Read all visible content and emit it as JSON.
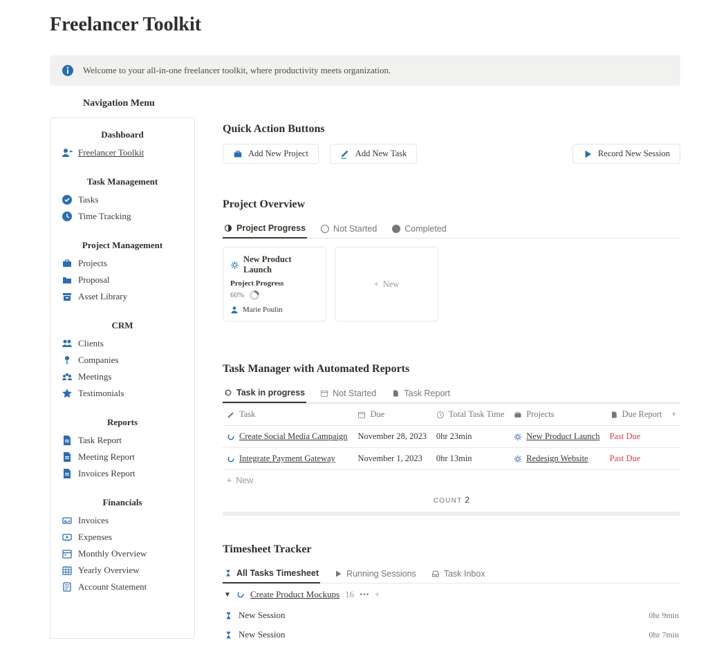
{
  "title": "Freelancer Toolkit",
  "callout": "Welcome to your all-in-one freelancer toolkit, where productivity meets organization.",
  "nav_title": "Navigation Menu",
  "sidebar": {
    "groups": [
      {
        "head": "Dashboard",
        "items": [
          {
            "icon": "user",
            "label": "Freelancer Toolkit",
            "underline": true
          }
        ]
      },
      {
        "head": "Task Management",
        "items": [
          {
            "icon": "check-circle",
            "label": "Tasks"
          },
          {
            "icon": "clock",
            "label": "Time Tracking"
          }
        ]
      },
      {
        "head": "Project Management",
        "items": [
          {
            "icon": "briefcase",
            "label": "Projects"
          },
          {
            "icon": "folder",
            "label": "Proposal"
          },
          {
            "icon": "archive",
            "label": "Asset Library"
          }
        ]
      },
      {
        "head": "CRM",
        "items": [
          {
            "icon": "users",
            "label": "Clients"
          },
          {
            "icon": "pin",
            "label": "Companies"
          },
          {
            "icon": "meeting",
            "label": "Meetings"
          },
          {
            "icon": "star",
            "label": "Testimonials"
          }
        ]
      },
      {
        "head": "Reports",
        "items": [
          {
            "icon": "report",
            "label": "Task Report"
          },
          {
            "icon": "report",
            "label": "Meeting Report"
          },
          {
            "icon": "report",
            "label": "Invoices Report"
          }
        ]
      },
      {
        "head": "Financials",
        "items": [
          {
            "icon": "invoice",
            "label": "Invoices"
          },
          {
            "icon": "expense",
            "label": "Expenses"
          },
          {
            "icon": "calendar",
            "label": "Monthly Overview"
          },
          {
            "icon": "grid",
            "label": "Yearly Overview"
          },
          {
            "icon": "statement",
            "label": "Account Statement"
          }
        ]
      }
    ]
  },
  "quick": {
    "heading": "Quick Action Buttons",
    "buttons": [
      {
        "icon": "briefcase",
        "label": "Add New Project"
      },
      {
        "icon": "pencil",
        "label": "Add New Task"
      },
      {
        "icon": "play",
        "label": "Record New Session"
      }
    ]
  },
  "overview": {
    "heading": "Project Overview",
    "tabs": [
      {
        "label": "Project Progress",
        "active": true
      },
      {
        "label": "Not Started"
      },
      {
        "label": "Completed"
      }
    ],
    "card": {
      "title": "New Product Launch",
      "sub": "Project Progress",
      "percent": "60%",
      "author": "Marie Poulin"
    },
    "new_label": "New"
  },
  "tasks": {
    "heading": "Task Manager with Automated Reports",
    "tabs": [
      {
        "label": "Task in progress",
        "active": true
      },
      {
        "label": "Not Started"
      },
      {
        "label": "Task Report"
      }
    ],
    "columns": [
      "Task",
      "Due",
      "Total Task Time",
      "Projects",
      "Due Report"
    ],
    "rows": [
      {
        "task": "Create Social Media Campaign",
        "due": "November 28, 2023",
        "time": "0hr 23min",
        "project": "New Product Launch",
        "report": "Past Due"
      },
      {
        "task": "Integrate Payment Gateway",
        "due": "November 1, 2023",
        "time": "0hr 13min",
        "project": "Redesign Website",
        "report": "Past Due"
      }
    ],
    "new_label": "New",
    "count_label": "COUNT",
    "count_value": "2"
  },
  "timesheet": {
    "heading": "Timesheet Tracker",
    "tabs": [
      {
        "label": "All Tasks Timesheet",
        "active": true
      },
      {
        "label": "Running Sessions"
      },
      {
        "label": "Task Inbox"
      }
    ],
    "group": {
      "name": "Create Product Mockups",
      "count": "16"
    },
    "rows": [
      {
        "name": "New Session",
        "dur": "0hr 9min"
      },
      {
        "name": "New Session",
        "dur": "0hr 7min"
      }
    ]
  }
}
